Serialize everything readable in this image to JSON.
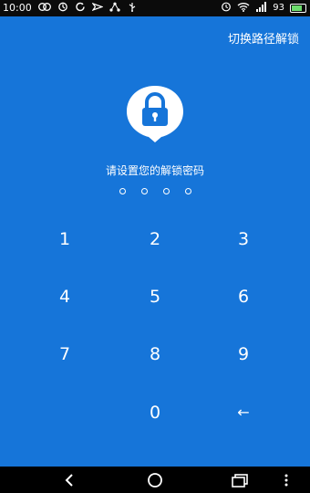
{
  "status_bar": {
    "time": "10:00",
    "battery": "93",
    "icons": [
      "sim-icon",
      "sync-icon",
      "refresh-icon",
      "sendanywhere-icon",
      "share-icon",
      "usb-icon",
      "alarm-icon",
      "wifi-icon",
      "signal-icon",
      "battery-icon"
    ]
  },
  "header": {
    "switch_label": "切换路径解锁"
  },
  "lock": {
    "icon": "lock-icon"
  },
  "prompt": {
    "title": "请设置您的解锁密码",
    "dot_count": 4
  },
  "keypad": {
    "k1": "1",
    "k2": "2",
    "k3": "3",
    "k4": "4",
    "k5": "5",
    "k6": "6",
    "k7": "7",
    "k8": "8",
    "k9": "9",
    "k0": "0",
    "back": "←"
  },
  "nav_bar": {
    "icons": [
      "back-icon",
      "home-icon",
      "recents-icon",
      "more-icon"
    ]
  },
  "colors": {
    "background": "#1675d9",
    "bars": "#000000",
    "text": "#ffffff",
    "lock_glyph": "#1675d9"
  }
}
